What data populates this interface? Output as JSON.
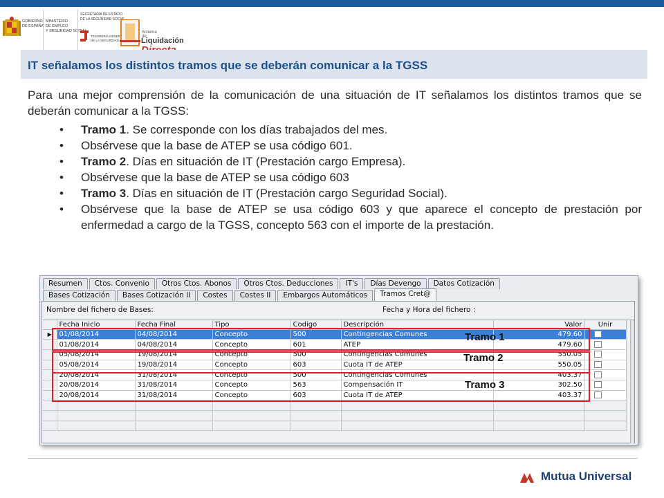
{
  "header": {
    "gob_text": [
      "GOBIERNO",
      "DE ESPAÑA"
    ],
    "ministerio_text": [
      "MINISTERIO",
      "DE EMPLEO",
      "Y SEGURIDAD SOCIAL"
    ],
    "secretaria_text": [
      "SECRETARÍA DE ESTADO",
      "DE LA SEGURIDAD SOCIAL"
    ],
    "tesoreria_text": [
      "TESORERÍA GENERAL",
      "DE LA SEGURIDAD SOCIAL"
    ],
    "sld_small": "Sistema de",
    "sld_liq": "Liquidación",
    "sld_dir": "Directa",
    "colors": {
      "top_bar": "#1d5aa0",
      "title_text": "#1d4f8a",
      "red": "#e0212b"
    }
  },
  "title": "IT señalamos los distintos tramos que se deberán comunicar a la TGSS",
  "intro": "Para una mejor comprensión de la comunicación de una situación de IT señalamos los distintos tramos que se deberán comunicar a la TGSS:",
  "bullets": [
    {
      "bold": "Tramo 1",
      "text": ". Se corresponde con los días trabajados del mes."
    },
    {
      "bold": "",
      "text": "Obsérvese que la base de ATEP se usa código 601."
    },
    {
      "bold": "Tramo 2",
      "text": ". Días en situación de IT (Prestación cargo Empresa)."
    },
    {
      "bold": "",
      "text": "Obsérvese que la base de ATEP se usa código 603"
    },
    {
      "bold": "Tramo 3",
      "text": ". Días en situación de IT (Prestación cargo Seguridad Social)."
    },
    {
      "bold": "",
      "text": "Obsérvese que la base de ATEP se usa código 603 y que aparece el concepto de prestación por enfermedad a cargo de la TGSS, concepto 563 con el importe de la prestación."
    }
  ],
  "window": {
    "tabs_row1": [
      "Resumen",
      "Ctos. Convenio",
      "Otros Ctos. Abonos",
      "Otros Ctos. Deducciones",
      "IT's",
      "Días Devengo",
      "Datos Cotización"
    ],
    "tabs_row2": [
      "Bases Cotización",
      "Bases Cotización II",
      "Costes",
      "Costes II",
      "Embargos Automáticos",
      "Tramos Cret@"
    ],
    "active_tab": "Tramos Cret@",
    "label_file": "Nombre del fichero de Bases:",
    "label_fecha": "Fecha y Hora del fichero :",
    "columns": [
      "Fecha Inicio",
      "Fecha Final",
      "Tipo",
      "Codigo",
      "Descripción",
      "Valor",
      "Unir"
    ],
    "rows": [
      [
        "01/08/2014",
        "04/08/2014",
        "Concepto",
        "500",
        "Contingencias Comunes",
        "479.60"
      ],
      [
        "01/08/2014",
        "04/08/2014",
        "Concepto",
        "601",
        "ATEP",
        "479.60"
      ],
      [
        "05/08/2014",
        "19/08/2014",
        "Concepto",
        "500",
        "Contingencias Comunes",
        "550.05"
      ],
      [
        "05/08/2014",
        "19/08/2014",
        "Concepto",
        "603",
        "Cuota IT de ATEP",
        "550.05"
      ],
      [
        "20/08/2014",
        "31/08/2014",
        "Concepto",
        "500",
        "Contingencias Comunes",
        "403.37"
      ],
      [
        "20/08/2014",
        "31/08/2014",
        "Concepto",
        "563",
        "Compensación IT",
        "302.50"
      ],
      [
        "20/08/2014",
        "31/08/2014",
        "Concepto",
        "603",
        "Cuota IT de ATEP",
        "403.37"
      ]
    ],
    "row_indicator": "▶",
    "tramo_labels": [
      "Tramo 1",
      "Tramo 2",
      "Tramo 3"
    ]
  },
  "footer": {
    "brand": "Mutua Universal"
  }
}
